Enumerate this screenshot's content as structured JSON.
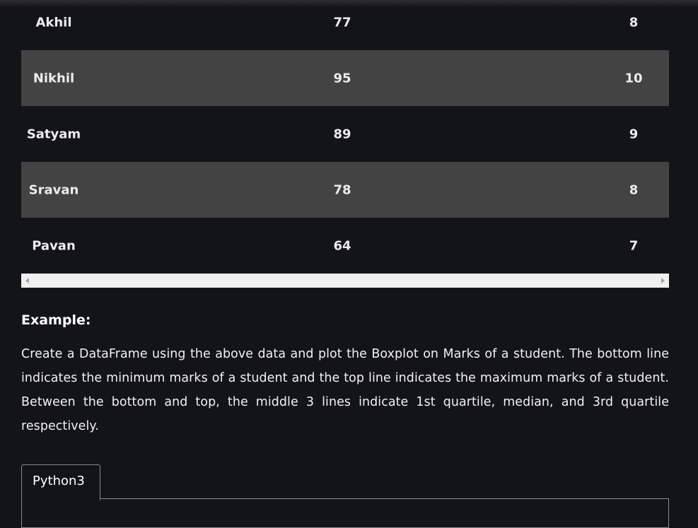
{
  "table": {
    "rows": [
      {
        "name": "Akhil",
        "marks": "77",
        "grade": "8"
      },
      {
        "name": "Nikhil",
        "marks": "95",
        "grade": "10"
      },
      {
        "name": "Satyam",
        "marks": "89",
        "grade": "9"
      },
      {
        "name": "Sravan",
        "marks": "78",
        "grade": "8"
      },
      {
        "name": "Pavan",
        "marks": "64",
        "grade": "7"
      }
    ]
  },
  "example": {
    "heading": "Example:",
    "text": "Create a DataFrame using the above data and plot the Boxplot on Marks of a student. The bottom line indicates the minimum marks of a student and the top line indicates the maximum marks of a student.  Between the bottom and top, the middle 3 lines indicate 1st quartile, median, and 3rd quartile respectively."
  },
  "code": {
    "tab_label": "Python3"
  },
  "icons": {
    "scroll_left": "chevron-left-icon",
    "scroll_right": "chevron-right-icon"
  },
  "colors": {
    "background": "#131417",
    "shaded_row": "#434343",
    "scrollbar": "#f0f0f0"
  }
}
